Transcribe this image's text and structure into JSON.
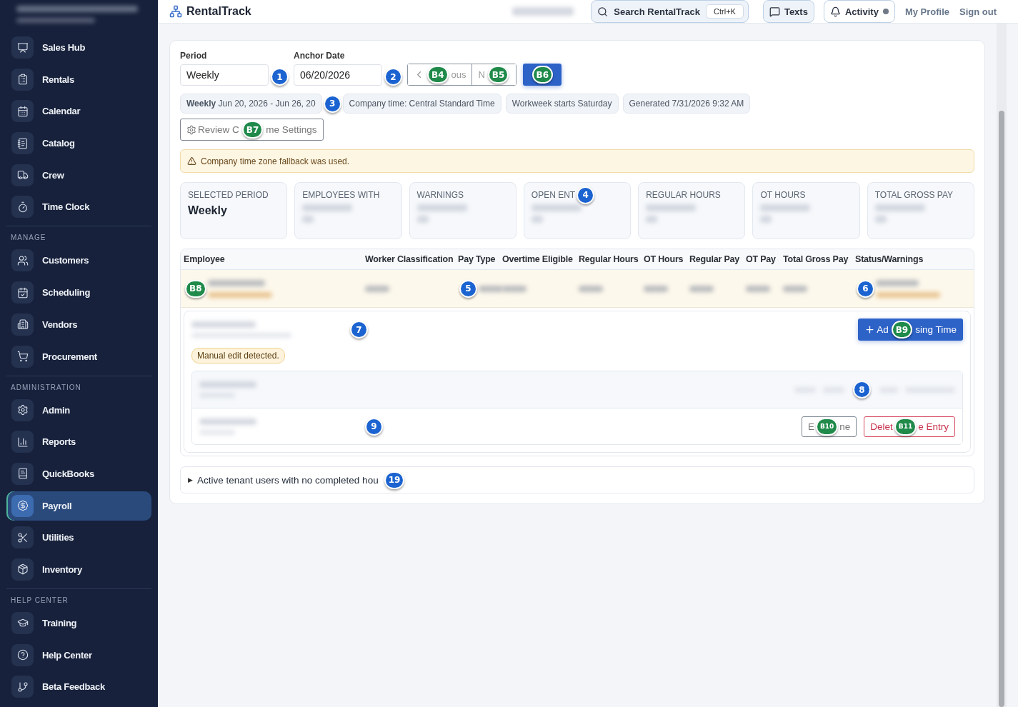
{
  "app": {
    "name": "RentalTrack"
  },
  "header": {
    "search": {
      "label": "Search RentalTrack",
      "shortcut": "Ctrl+K"
    },
    "texts": "Texts",
    "activity": {
      "label": "Activity",
      "unread": true
    },
    "links": [
      "My Profile",
      "Sign out"
    ]
  },
  "sidebar": {
    "sections": [
      {
        "items": [
          {
            "label": "Sales Hub",
            "selected": false
          },
          {
            "label": "Rentals",
            "selected": false
          },
          {
            "label": "Calendar",
            "selected": false
          },
          {
            "label": "Catalog",
            "selected": false
          },
          {
            "label": "Crew",
            "selected": false
          },
          {
            "label": "Time Clock",
            "selected": false
          }
        ]
      },
      {
        "title": "MANAGE",
        "items": [
          {
            "label": "Customers",
            "selected": false
          },
          {
            "label": "Scheduling",
            "selected": false
          },
          {
            "label": "Vendors",
            "selected": false
          },
          {
            "label": "Procurement",
            "selected": false
          }
        ]
      },
      {
        "title": "ADMINISTRATION",
        "items": [
          {
            "label": "Admin",
            "selected": false
          },
          {
            "label": "Reports",
            "selected": false
          },
          {
            "label": "QuickBooks",
            "selected": false
          },
          {
            "label": "Payroll",
            "selected": true
          },
          {
            "label": "Utilities",
            "selected": false
          },
          {
            "label": "Inventory",
            "selected": false
          }
        ]
      },
      {
        "title": "HELP CENTER",
        "items": [
          {
            "label": "Training",
            "selected": false
          },
          {
            "label": "Help Center",
            "selected": false
          },
          {
            "label": "Beta Feedback",
            "selected": false
          }
        ]
      }
    ]
  },
  "filters": {
    "period": {
      "label": "Period",
      "value": "Weekly",
      "marker": {
        "label": "1",
        "kind": "step"
      }
    },
    "anchor_date": {
      "label": "Anchor Date",
      "value": "06/20/2026",
      "marker": {
        "label": "2",
        "kind": "step"
      }
    },
    "previous": [
      {
        "marker": "B4",
        "kind": "button"
      },
      {
        "text": "ous"
      }
    ],
    "next": [
      {
        "text": "N"
      },
      {
        "marker": "B5",
        "kind": "button"
      }
    ],
    "primary": [
      {
        "marker": "B6",
        "kind": "button"
      }
    ]
  },
  "chips": [
    {
      "bold": "Weekly",
      "text": "Jun 20, 2026 - Jun 26, 20",
      "marker": {
        "label": "3",
        "kind": "step"
      }
    },
    {
      "text": "Company time: Central Standard Time"
    },
    {
      "text": "Workweek starts Saturday"
    },
    {
      "text": "Generated 7/31/2026 9:32 AM"
    }
  ],
  "settings_button": [
    {
      "text": "Review C"
    },
    {
      "marker": "B7",
      "kind": "button"
    },
    {
      "text": "me Settings"
    }
  ],
  "alert": {
    "text": "Company time zone fallback was used."
  },
  "metrics": [
    {
      "label": [
        {
          "text": "SELECTED PERIOD"
        }
      ],
      "value": "Weekly"
    },
    {
      "label": [
        {
          "text": "EMPLOYEES WITH"
        }
      ]
    },
    {
      "label": [
        {
          "text": "WARNINGS"
        }
      ]
    },
    {
      "label": [
        {
          "text": "OPEN ENT"
        },
        {
          "marker": "4",
          "kind": "step"
        }
      ]
    },
    {
      "label": [
        {
          "text": "REGULAR HOURS"
        }
      ]
    },
    {
      "label": [
        {
          "text": "OT HOURS"
        }
      ]
    },
    {
      "label": [
        {
          "text": "TOTAL GROSS PAY"
        }
      ]
    }
  ],
  "table": {
    "columns": [
      "Employee",
      "Worker Classification",
      "Pay Type",
      "Overtime Eligible",
      "Regular Hours",
      "OT Hours",
      "Regular Pay",
      "OT Pay",
      "Total Gross Pay",
      "Status/Warnings"
    ],
    "rows": [
      {
        "expanded": true,
        "employee_marker": {
          "label": "B8",
          "kind": "button"
        },
        "pay_type_marker": {
          "label": "5",
          "kind": "step"
        },
        "status_marker": {
          "label": "6",
          "kind": "step"
        }
      }
    ]
  },
  "detail": {
    "marker": {
      "label": "7",
      "kind": "step"
    },
    "add_button": [
      {
        "text": "Ad"
      },
      {
        "marker": "B9",
        "kind": "button"
      },
      {
        "text": "sing Time"
      }
    ],
    "badge": "Manual edit detected.",
    "entries": [
      {
        "marker": {
          "label": "8",
          "kind": "step"
        }
      },
      {
        "marker": {
          "label": "9",
          "kind": "step"
        },
        "actions": [
          {
            "kind": "neutral",
            "parts": [
              {
                "text": "E"
              },
              {
                "marker": "B10",
                "kind": "button"
              },
              {
                "text": "ne"
              }
            ]
          },
          {
            "kind": "danger",
            "parts": [
              {
                "text": "Delet"
              },
              {
                "marker": "B11",
                "kind": "button"
              },
              {
                "text": "e Entry"
              }
            ]
          }
        ]
      }
    ]
  },
  "collapsible": {
    "toggle": "▶",
    "expanded": false,
    "text": "Active tenant users with no completed hou",
    "marker": {
      "label": "19",
      "kind": "step"
    }
  }
}
